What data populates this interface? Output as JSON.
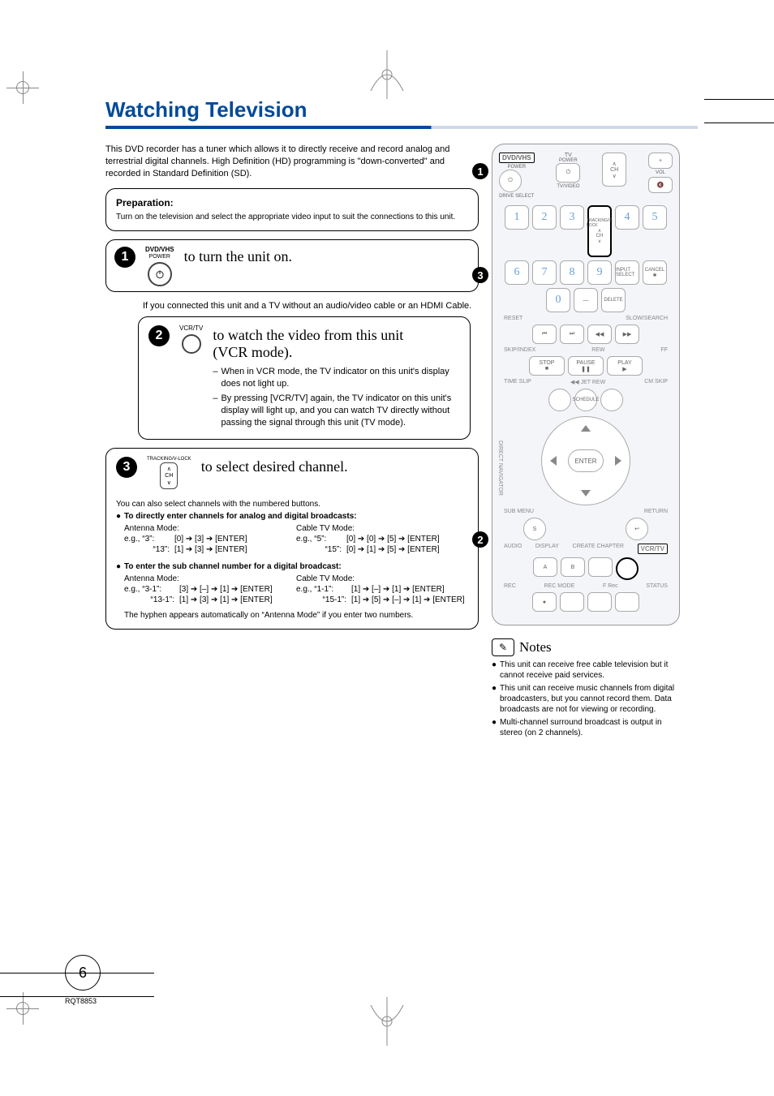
{
  "title": "Watching Television",
  "intro": "This DVD recorder has a tuner which allows it to directly receive and record analog and terrestrial digital channels. High Definition (HD) programming is \"down-converted\" and recorded in Standard Definition (SD).",
  "prep": {
    "heading": "Preparation:",
    "text": "Turn on the television and select the appropriate video input to suit the connections to this unit."
  },
  "step1": {
    "btn_top": "DVD/VHS",
    "btn_sub": "POWER",
    "text": "to turn the unit on."
  },
  "step1_note": "If you connected this unit and a TV without an audio/video cable or an HDMI Cable.",
  "step2": {
    "btn_label": "VCR/TV",
    "text1": "to watch the video from this unit",
    "text2": "(VCR mode).",
    "dash1": "When in VCR mode, the TV indicator on this unit's display does not light up.",
    "dash2": "By pressing [VCR/TV] again, the TV indicator on this unit's display will light up, and you can watch TV directly without passing the signal through this unit (TV mode)."
  },
  "step3": {
    "btn_top": "TRACKING/V-LOCK",
    "btn_mid": "CH",
    "text": "to select desired channel."
  },
  "channels": {
    "intro": "You can also select channels with the numbered buttons.",
    "h1": "To directly enter channels for analog and digital broadcasts:",
    "ant_label": "Antenna Mode:",
    "ant_eg1a": "e.g., “3”:",
    "ant_eg1b": "[0] ➔ [3] ➔ [ENTER]",
    "ant_eg2a": "“13”:",
    "ant_eg2b": "[1] ➔ [3] ➔ [ENTER]",
    "cab_label": "Cable TV Mode:",
    "cab_eg1a": "e.g., “5”:",
    "cab_eg1b": "[0] ➔ [0] ➔ [5] ➔ [ENTER]",
    "cab_eg2a": "“15”:",
    "cab_eg2b": "[0] ➔ [1] ➔ [5] ➔ [ENTER]",
    "h2": "To enter the sub channel number for a digital broadcast:",
    "s_ant_eg1a": "e.g., “3-1”:",
    "s_ant_eg1b": "[3] ➔ [–] ➔ [1] ➔ [ENTER]",
    "s_ant_eg2a": "“13-1”:",
    "s_ant_eg2b": "[1] ➔ [3] ➔ [1] ➔ [ENTER]",
    "s_cab_eg1a": "e.g., “1-1”:",
    "s_cab_eg1b": "[1] ➔ [–] ➔ [1] ➔ [ENTER]",
    "s_cab_eg2a": "“15-1”:",
    "s_cab_eg2b": "[1] ➔ [5] ➔ [–] ➔ [1] ➔ [ENTER]",
    "hyphen_note": "The hyphen appears automatically on “Antenna Mode” if you enter two numbers."
  },
  "remote": {
    "dvdvhs": "DVD/VHS",
    "power": "POWER",
    "tv": "TV",
    "tvvideo": "TV/VIDEO",
    "ch": "CH",
    "vol": "VOL",
    "drive_select": "DRIVE SELECT",
    "keys": [
      "1",
      "2",
      "3",
      "4",
      "5",
      "6",
      "7",
      "8",
      "9",
      "0"
    ],
    "tracking": "TRACKING/V-LOCK",
    "input_select": "INPUT SELECT",
    "cancel": "CANCEL",
    "reset": "RESET",
    "delete": "DELETE",
    "slowsearch": "SLOW/SEARCH",
    "skipindex": "SKIP/INDEX",
    "rew": "REW",
    "ff": "FF",
    "stop": "STOP",
    "pause": "PAUSE",
    "play": "PLAY",
    "timeslip": "TIME SLIP",
    "jetrew": "JET REW",
    "cmskip": "CM SKIP",
    "schedule": "SCHEDULE",
    "directnav": "DIRECT NAVIGATOR",
    "enter": "ENTER",
    "submenu": "SUB MENU",
    "return": "RETURN",
    "s": "S",
    "audio": "AUDIO",
    "display": "DISPLAY",
    "create_chapter": "CREATE CHAPTER",
    "vcrtv": "VCR/TV",
    "a": "A",
    "b": "B",
    "rec": "REC",
    "recmode": "REC MODE",
    "frec": "F Rec",
    "status": "STATUS"
  },
  "notes": {
    "heading": "Notes",
    "n1": "This unit can receive free cable television but it cannot receive paid services.",
    "n2": "This unit can receive music channels from digital broadcasters, but you cannot record them. Data broadcasts are not for viewing or recording.",
    "n3": "Multi-channel surround broadcast is output in stereo (on 2 channels)."
  },
  "page_number": "6",
  "footer": "RQT8853"
}
